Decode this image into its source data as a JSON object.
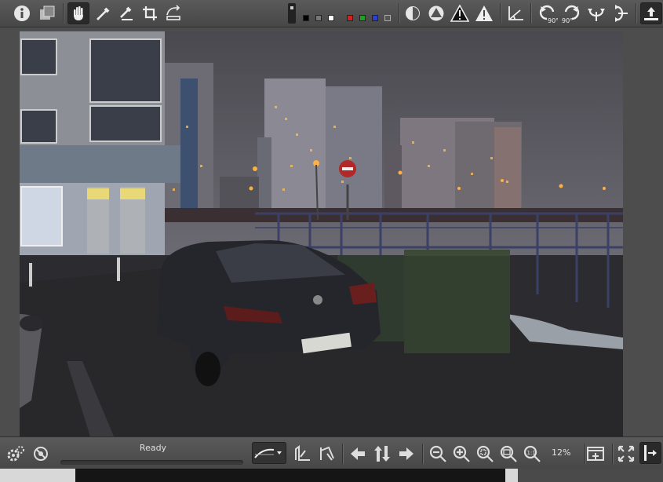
{
  "statusbar": {
    "status_text": "Ready",
    "zoom_level": "12%"
  },
  "toolbar": {
    "icons": [
      "info-icon",
      "compare-icon",
      "hand-icon",
      "eyedropper-icon",
      "white-balance-picker-icon",
      "crop-icon",
      "straighten-icon",
      "swatch-black-icon",
      "swatch-gray-icon",
      "swatch-white-icon",
      "swatch-red-icon",
      "swatch-green-icon",
      "swatch-blue-icon",
      "focus-mask-icon",
      "shadow-clipping-icon",
      "highlight-clipping-warning-icon",
      "highlight-clipping-alert-icon",
      "perspective-icon",
      "rotate-left-icon",
      "rotate-right-icon",
      "flip-horizontal-icon",
      "flip-vertical-icon",
      "collapse-toolbar-icon"
    ]
  },
  "colors": {
    "swatch_black": "#000000",
    "swatch_gray": "#777777",
    "swatch_white": "#ffffff",
    "swatch_red": "#d42020",
    "swatch_green": "#1fa01f",
    "swatch_blue": "#2a3fd4"
  }
}
